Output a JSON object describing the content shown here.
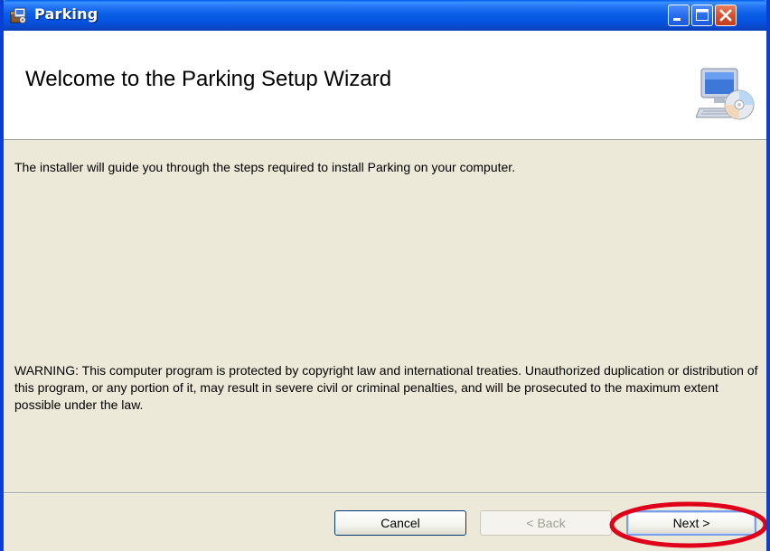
{
  "window": {
    "title": "Parking",
    "app_icon": "installer-package-icon",
    "controls": {
      "minimize_icon": "minimize-icon",
      "maximize_icon": "maximize-icon",
      "close_icon": "close-icon"
    }
  },
  "header": {
    "title": "Welcome to the Parking Setup Wizard",
    "graphic": "computer-cd-icon"
  },
  "body": {
    "intro": "The installer will guide you through the steps required to install Parking on your computer.",
    "warning": "WARNING: This computer program is protected by copyright law and international treaties. Unauthorized duplication or distribution of this program, or any portion of it, may result in severe civil or criminal penalties, and will be prosecuted to the maximum extent possible under the law."
  },
  "buttons": {
    "cancel": "Cancel",
    "back": "< Back",
    "next": "Next >",
    "back_disabled": true
  },
  "annotation": {
    "highlight_color": "#e0001a",
    "highlighted_target": "Next >"
  },
  "colors": {
    "titlebar": "#0a5fe6",
    "dialog_background": "#ece9d8",
    "header_background": "#ffffff",
    "close_button": "#d6512f"
  }
}
